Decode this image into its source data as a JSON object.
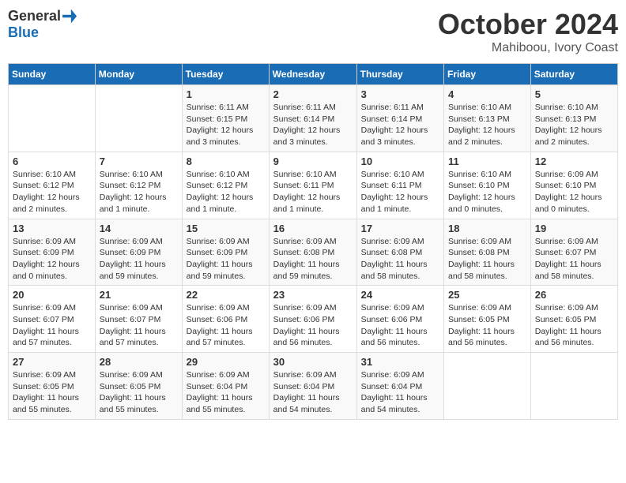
{
  "logo": {
    "general": "General",
    "blue": "Blue"
  },
  "header": {
    "month": "October 2024",
    "location": "Mahiboou, Ivory Coast"
  },
  "weekdays": [
    "Sunday",
    "Monday",
    "Tuesday",
    "Wednesday",
    "Thursday",
    "Friday",
    "Saturday"
  ],
  "weeks": [
    [
      {
        "day": "",
        "info": ""
      },
      {
        "day": "",
        "info": ""
      },
      {
        "day": "1",
        "info": "Sunrise: 6:11 AM\nSunset: 6:15 PM\nDaylight: 12 hours and 3 minutes."
      },
      {
        "day": "2",
        "info": "Sunrise: 6:11 AM\nSunset: 6:14 PM\nDaylight: 12 hours and 3 minutes."
      },
      {
        "day": "3",
        "info": "Sunrise: 6:11 AM\nSunset: 6:14 PM\nDaylight: 12 hours and 3 minutes."
      },
      {
        "day": "4",
        "info": "Sunrise: 6:10 AM\nSunset: 6:13 PM\nDaylight: 12 hours and 2 minutes."
      },
      {
        "day": "5",
        "info": "Sunrise: 6:10 AM\nSunset: 6:13 PM\nDaylight: 12 hours and 2 minutes."
      }
    ],
    [
      {
        "day": "6",
        "info": "Sunrise: 6:10 AM\nSunset: 6:12 PM\nDaylight: 12 hours and 2 minutes."
      },
      {
        "day": "7",
        "info": "Sunrise: 6:10 AM\nSunset: 6:12 PM\nDaylight: 12 hours and 1 minute."
      },
      {
        "day": "8",
        "info": "Sunrise: 6:10 AM\nSunset: 6:12 PM\nDaylight: 12 hours and 1 minute."
      },
      {
        "day": "9",
        "info": "Sunrise: 6:10 AM\nSunset: 6:11 PM\nDaylight: 12 hours and 1 minute."
      },
      {
        "day": "10",
        "info": "Sunrise: 6:10 AM\nSunset: 6:11 PM\nDaylight: 12 hours and 1 minute."
      },
      {
        "day": "11",
        "info": "Sunrise: 6:10 AM\nSunset: 6:10 PM\nDaylight: 12 hours and 0 minutes."
      },
      {
        "day": "12",
        "info": "Sunrise: 6:09 AM\nSunset: 6:10 PM\nDaylight: 12 hours and 0 minutes."
      }
    ],
    [
      {
        "day": "13",
        "info": "Sunrise: 6:09 AM\nSunset: 6:09 PM\nDaylight: 12 hours and 0 minutes."
      },
      {
        "day": "14",
        "info": "Sunrise: 6:09 AM\nSunset: 6:09 PM\nDaylight: 11 hours and 59 minutes."
      },
      {
        "day": "15",
        "info": "Sunrise: 6:09 AM\nSunset: 6:09 PM\nDaylight: 11 hours and 59 minutes."
      },
      {
        "day": "16",
        "info": "Sunrise: 6:09 AM\nSunset: 6:08 PM\nDaylight: 11 hours and 59 minutes."
      },
      {
        "day": "17",
        "info": "Sunrise: 6:09 AM\nSunset: 6:08 PM\nDaylight: 11 hours and 58 minutes."
      },
      {
        "day": "18",
        "info": "Sunrise: 6:09 AM\nSunset: 6:08 PM\nDaylight: 11 hours and 58 minutes."
      },
      {
        "day": "19",
        "info": "Sunrise: 6:09 AM\nSunset: 6:07 PM\nDaylight: 11 hours and 58 minutes."
      }
    ],
    [
      {
        "day": "20",
        "info": "Sunrise: 6:09 AM\nSunset: 6:07 PM\nDaylight: 11 hours and 57 minutes."
      },
      {
        "day": "21",
        "info": "Sunrise: 6:09 AM\nSunset: 6:07 PM\nDaylight: 11 hours and 57 minutes."
      },
      {
        "day": "22",
        "info": "Sunrise: 6:09 AM\nSunset: 6:06 PM\nDaylight: 11 hours and 57 minutes."
      },
      {
        "day": "23",
        "info": "Sunrise: 6:09 AM\nSunset: 6:06 PM\nDaylight: 11 hours and 56 minutes."
      },
      {
        "day": "24",
        "info": "Sunrise: 6:09 AM\nSunset: 6:06 PM\nDaylight: 11 hours and 56 minutes."
      },
      {
        "day": "25",
        "info": "Sunrise: 6:09 AM\nSunset: 6:05 PM\nDaylight: 11 hours and 56 minutes."
      },
      {
        "day": "26",
        "info": "Sunrise: 6:09 AM\nSunset: 6:05 PM\nDaylight: 11 hours and 56 minutes."
      }
    ],
    [
      {
        "day": "27",
        "info": "Sunrise: 6:09 AM\nSunset: 6:05 PM\nDaylight: 11 hours and 55 minutes."
      },
      {
        "day": "28",
        "info": "Sunrise: 6:09 AM\nSunset: 6:05 PM\nDaylight: 11 hours and 55 minutes."
      },
      {
        "day": "29",
        "info": "Sunrise: 6:09 AM\nSunset: 6:04 PM\nDaylight: 11 hours and 55 minutes."
      },
      {
        "day": "30",
        "info": "Sunrise: 6:09 AM\nSunset: 6:04 PM\nDaylight: 11 hours and 54 minutes."
      },
      {
        "day": "31",
        "info": "Sunrise: 6:09 AM\nSunset: 6:04 PM\nDaylight: 11 hours and 54 minutes."
      },
      {
        "day": "",
        "info": ""
      },
      {
        "day": "",
        "info": ""
      }
    ]
  ]
}
